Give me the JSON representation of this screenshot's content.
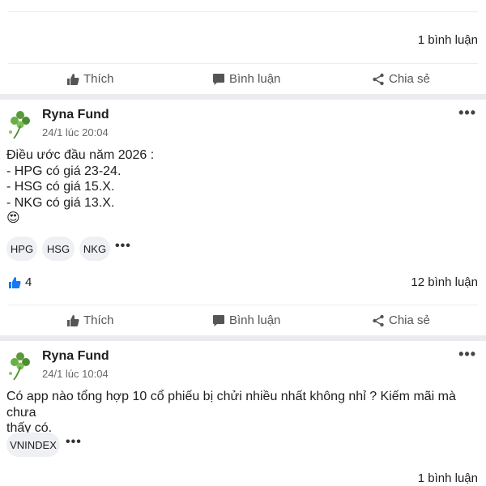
{
  "action_bar": {
    "like_label": "Thích",
    "comment_label": "Bình luận",
    "share_label": "Chia sẻ"
  },
  "post_top": {
    "comment_count": "1 bình luận"
  },
  "post_1": {
    "author": "Ryna Fund",
    "time": "24/1 lúc 20:04",
    "lines": [
      "Điều ước đầu năm 2026 :",
      "- HPG có giá 23-24.",
      "- HSG có giá 15.X.",
      "- NKG có giá 13.X."
    ],
    "emoji": "😍",
    "tags": [
      "HPG",
      "HSG",
      "NKG"
    ],
    "likes": "4",
    "comment_count": "12 bình luận"
  },
  "post_2": {
    "author": "Ryna Fund",
    "time": "24/1 lúc 10:04",
    "lines": [
      "Có app nào tổng hợp 10 cổ phiếu bị chửi nhiều nhất không nhỉ ? Kiếm mãi mà chưa",
      "thấy có."
    ],
    "tags": [
      "VNINDEX"
    ],
    "comment_count": "1 bình luận"
  },
  "colors": {
    "like_blue": "#1877f2",
    "avatar_green": "#5a9a3a"
  }
}
